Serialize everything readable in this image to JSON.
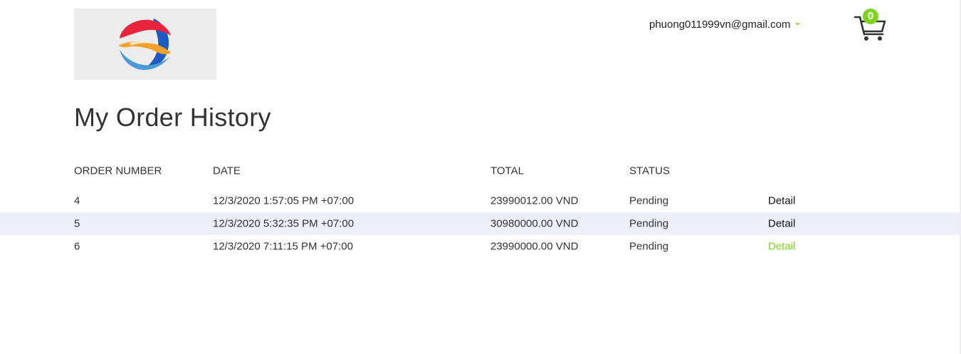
{
  "header": {
    "account_email": "phuong011999vn@gmail.com",
    "cart_count": "0"
  },
  "page": {
    "title": "My Order History"
  },
  "table": {
    "columns": [
      "ORDER NUMBER",
      "DATE",
      "TOTAL",
      "STATUS"
    ],
    "rows": [
      {
        "order_number": "4",
        "date": "12/3/2020 1:57:05 PM +07:00",
        "total": "23990012.00 VND",
        "status": "Pending",
        "action": "Detail"
      },
      {
        "order_number": "5",
        "date": "12/3/2020 5:32:35 PM +07:00",
        "total": "30980000.00 VND",
        "status": "Pending",
        "action": "Detail"
      },
      {
        "order_number": "6",
        "date": "12/3/2020 7:11:15 PM +07:00",
        "total": "23990000.00 VND",
        "status": "Pending",
        "action": "Detail"
      }
    ]
  },
  "colors": {
    "accent": "#7ed321",
    "row_stripe": "#eeeef9"
  },
  "icons": {
    "logo": "brand-globe-logo",
    "cart": "shopping-cart-icon",
    "dropdown": "chevron-down-icon"
  }
}
